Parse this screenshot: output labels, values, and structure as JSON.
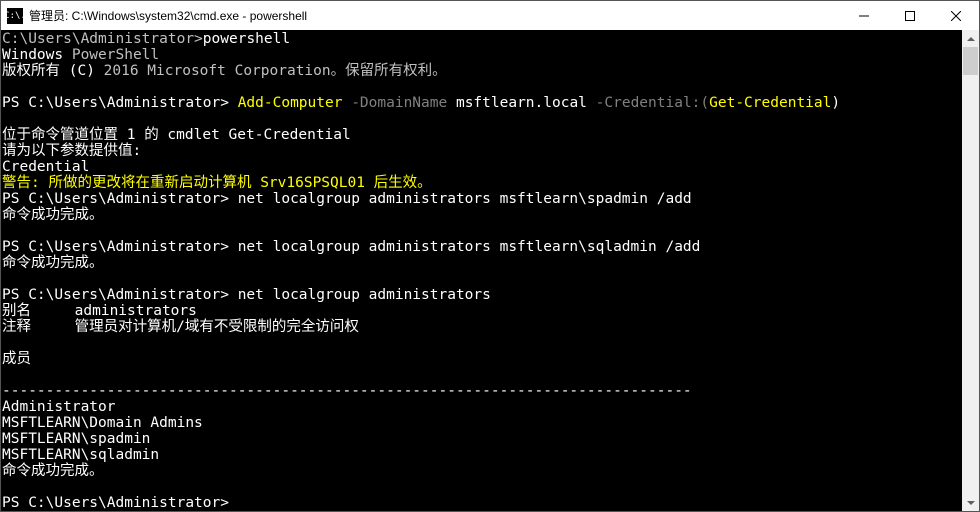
{
  "window": {
    "icon_label": "C:\\.",
    "title": "管理员: C:\\Windows\\system32\\cmd.exe - powershell"
  },
  "colors": {
    "yellow": "#ffff00",
    "gray": "#808080",
    "white": "#ffffff"
  },
  "t": {
    "l1a": "C:\\Users\\Administrator>",
    "l1b": "powershell",
    "l2a": "Windows",
    "l2b": " PowerShell",
    "l3a": "版权所有 (C)",
    "l3b": " 2016 Microsoft Corporation。保留所有权利。",
    "l5a": "PS C:\\Users\\Administrator> ",
    "l5b": "Add-Computer",
    "l5c": " -DomainName",
    "l5d": " msftlearn.local",
    "l5e": " -Credential:(",
    "l5f": "Get-Credential",
    "l5g": ")",
    "l7": "位于命令管道位置 1 的 cmdlet Get-Credential",
    "l8": "请为以下参数提供值:",
    "l9": "Credential",
    "l10": "警告: 所做的更改将在重新启动计算机 Srv16SPSQL01 后生效。",
    "l11a": "PS C:\\Users\\Administrator> ",
    "l11b": "net localgroup administrators msftlearn\\spadmin /add",
    "l12": "命令成功完成。",
    "l14a": "PS C:\\Users\\Administrator> ",
    "l14b": "net localgroup administrators msftlearn\\sqladmin /add",
    "l15": "命令成功完成。",
    "l17a": "PS C:\\Users\\Administrator> ",
    "l17b": "net localgroup administrators",
    "l18": "别名     administrators",
    "l19": "注释     管理员对计算机/域有不受限制的完全访问权",
    "l21": "成员",
    "l23": "-------------------------------------------------------------------------------",
    "l24": "Administrator",
    "l25": "MSFTLEARN\\Domain Admins",
    "l26": "MSFTLEARN\\spadmin",
    "l27": "MSFTLEARN\\sqladmin",
    "l28": "命令成功完成。",
    "l30": "PS C:\\Users\\Administrator> "
  }
}
